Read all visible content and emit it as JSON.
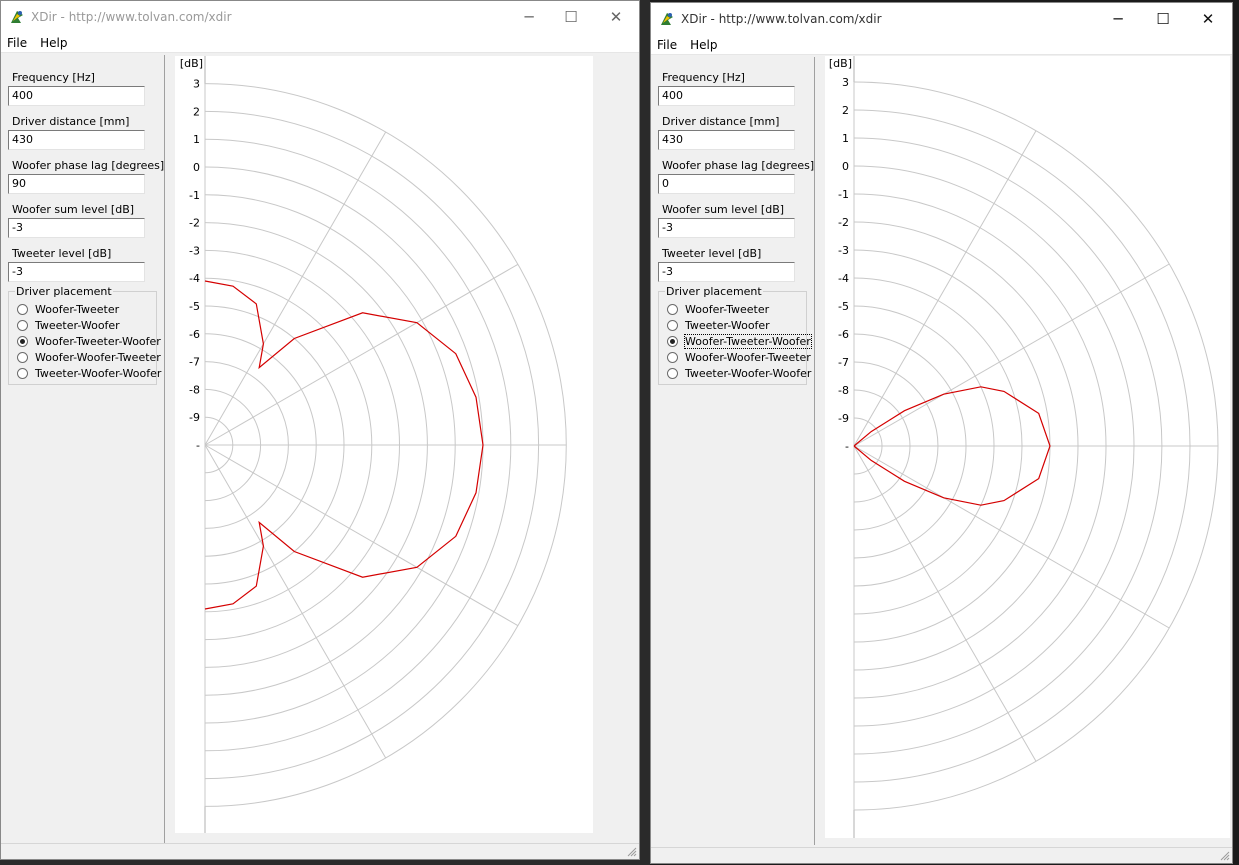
{
  "windows": [
    {
      "title": "XDir - http://www.tolvan.com/xdir",
      "menu": [
        "File",
        "Help"
      ],
      "fields": [
        {
          "label": "Frequency [Hz]",
          "value": "400"
        },
        {
          "label": "Driver distance [mm]",
          "value": "430"
        },
        {
          "label": "Woofer phase lag [degrees]",
          "value": "90"
        },
        {
          "label": "Woofer sum level [dB]",
          "value": "-3"
        },
        {
          "label": "Tweeter level [dB]",
          "value": "-3"
        }
      ],
      "placement": {
        "legend": "Driver placement",
        "options": [
          "Woofer-Tweeter",
          "Tweeter-Woofer",
          "Woofer-Tweeter-Woofer",
          "Woofer-Woofer-Tweeter",
          "Tweeter-Woofer-Woofer"
        ],
        "selected": 2
      },
      "plot": {
        "unit": "[dB]",
        "ticks": [
          "3",
          "2",
          "1",
          "0",
          "-1",
          "-2",
          "-3",
          "-4",
          "-5",
          "-6",
          "-7",
          "-8",
          "-9",
          "-"
        ]
      },
      "chart_data": {
        "type": "polar-directivity",
        "unit": "dB",
        "r_range_db": [
          -10,
          3
        ],
        "angle_range_deg": [
          -90,
          90
        ],
        "series": [
          {
            "color": "#d40000",
            "values_db": [
              [
                0,
                0
              ],
              [
                10,
                -0.1
              ],
              [
                20,
                -0.4
              ],
              [
                30,
                -1.2
              ],
              [
                40,
                -2.6
              ],
              [
                50,
                -5.0
              ],
              [
                55,
                -6.6
              ],
              [
                60,
                -5.8
              ],
              [
                70,
                -4.6
              ],
              [
                80,
                -4.2
              ],
              [
                90,
                -4.1
              ]
            ]
          }
        ]
      }
    },
    {
      "title": "XDir - http://www.tolvan.com/xdir",
      "menu": [
        "File",
        "Help"
      ],
      "fields": [
        {
          "label": "Frequency [Hz]",
          "value": "400"
        },
        {
          "label": "Driver distance [mm]",
          "value": "430"
        },
        {
          "label": "Woofer phase lag [degrees]",
          "value": "0"
        },
        {
          "label": "Woofer sum level [dB]",
          "value": "-3"
        },
        {
          "label": "Tweeter level [dB]",
          "value": "-3"
        }
      ],
      "placement": {
        "legend": "Driver placement",
        "options": [
          "Woofer-Tweeter",
          "Tweeter-Woofer",
          "Woofer-Tweeter-Woofer",
          "Woofer-Woofer-Tweeter",
          "Tweeter-Woofer-Woofer"
        ],
        "selected": 2
      },
      "plot": {
        "unit": "[dB]",
        "ticks": [
          "3",
          "2",
          "1",
          "0",
          "-1",
          "-2",
          "-3",
          "-4",
          "-5",
          "-6",
          "-7",
          "-8",
          "-9",
          "-"
        ]
      },
      "chart_data": {
        "type": "polar-directivity",
        "unit": "dB",
        "r_range_db": [
          -10,
          3
        ],
        "angle_range_deg": [
          -90,
          90
        ],
        "series": [
          {
            "color": "#d40000",
            "values_db": [
              [
                0,
                -3
              ],
              [
                10,
                -3.3
              ],
              [
                20,
                -4.3
              ],
              [
                25,
                -5.0
              ],
              [
                30,
                -6.3
              ],
              [
                35,
                -7.8
              ],
              [
                40,
                -9.2
              ],
              [
                45,
                -10
              ]
            ]
          }
        ]
      }
    }
  ]
}
